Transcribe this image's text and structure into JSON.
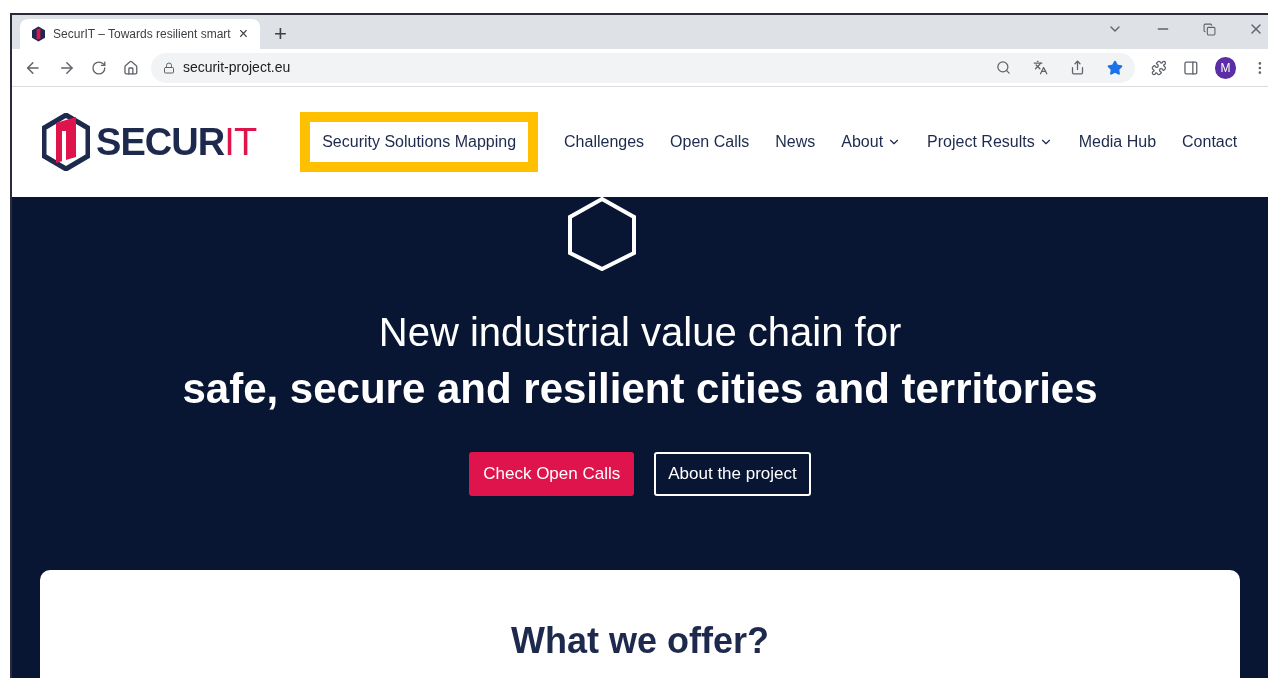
{
  "browser": {
    "tab": {
      "title": "SecurIT – Towards resilient smart",
      "close": "×"
    },
    "new_tab": "+",
    "url": "securit-project.eu",
    "avatar": "M"
  },
  "logo": {
    "main": "SECUR",
    "accent": "IT"
  },
  "nav": [
    {
      "label": "Security Solutions Mapping",
      "has_menu": false,
      "highlighted": true
    },
    {
      "label": "Challenges",
      "has_menu": false,
      "highlighted": false
    },
    {
      "label": "Open Calls",
      "has_menu": false,
      "highlighted": false
    },
    {
      "label": "News",
      "has_menu": false,
      "highlighted": false
    },
    {
      "label": "About",
      "has_menu": true,
      "highlighted": false
    },
    {
      "label": "Project Results",
      "has_menu": true,
      "highlighted": false
    },
    {
      "label": "Media Hub",
      "has_menu": false,
      "highlighted": false
    },
    {
      "label": "Contact",
      "has_menu": false,
      "highlighted": false
    }
  ],
  "hero": {
    "title_light": "New industrial value chain for",
    "title_bold": "safe, secure and resilient cities and territories",
    "buttons": [
      {
        "label": "Check Open Calls",
        "kind": "primary"
      },
      {
        "label": "About the project",
        "kind": "outline"
      }
    ]
  },
  "card": {
    "title": "What we offer?"
  }
}
